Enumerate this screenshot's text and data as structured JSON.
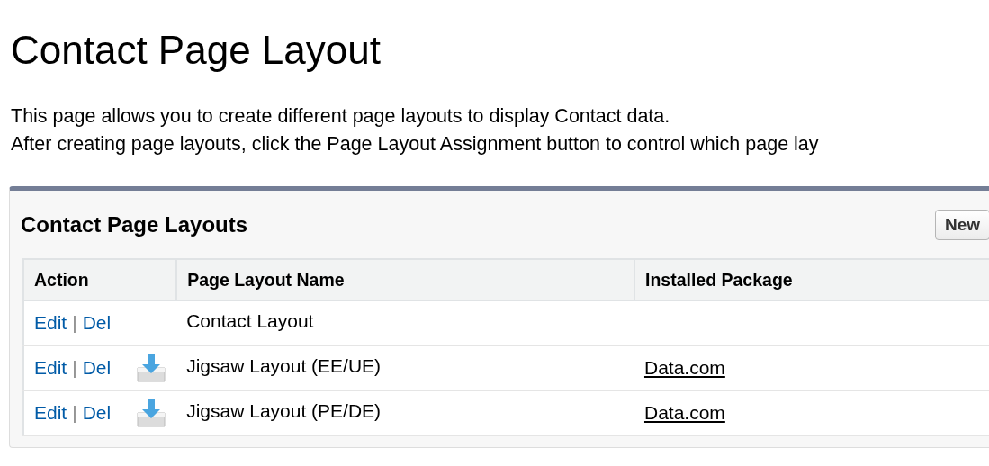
{
  "page": {
    "title": "Contact Page Layout",
    "description": [
      "This page allows you to create different page layouts to display Contact data.",
      "After creating page layouts, click the Page Layout Assignment button to control which page lay"
    ]
  },
  "panel": {
    "title": "Contact Page Layouts",
    "buttons": [
      "New"
    ],
    "table": {
      "columns": [
        "Action",
        "Page Layout Name",
        "Installed Package"
      ],
      "rows": [
        {
          "edit": "Edit",
          "separator": "|",
          "delete": "Del",
          "installed": false,
          "name": "Contact Layout"
        },
        {
          "edit": "Edit",
          "separator": "|",
          "delete": "Del",
          "installed": true,
          "name": "Jigsaw Layout (EE/UE)",
          "package": "Data.com"
        },
        {
          "edit": "Edit",
          "separator": "|",
          "delete": "Del",
          "installed": true,
          "name": "Jigsaw Layout (PE/DE)",
          "package": "Data.com"
        }
      ]
    }
  }
}
